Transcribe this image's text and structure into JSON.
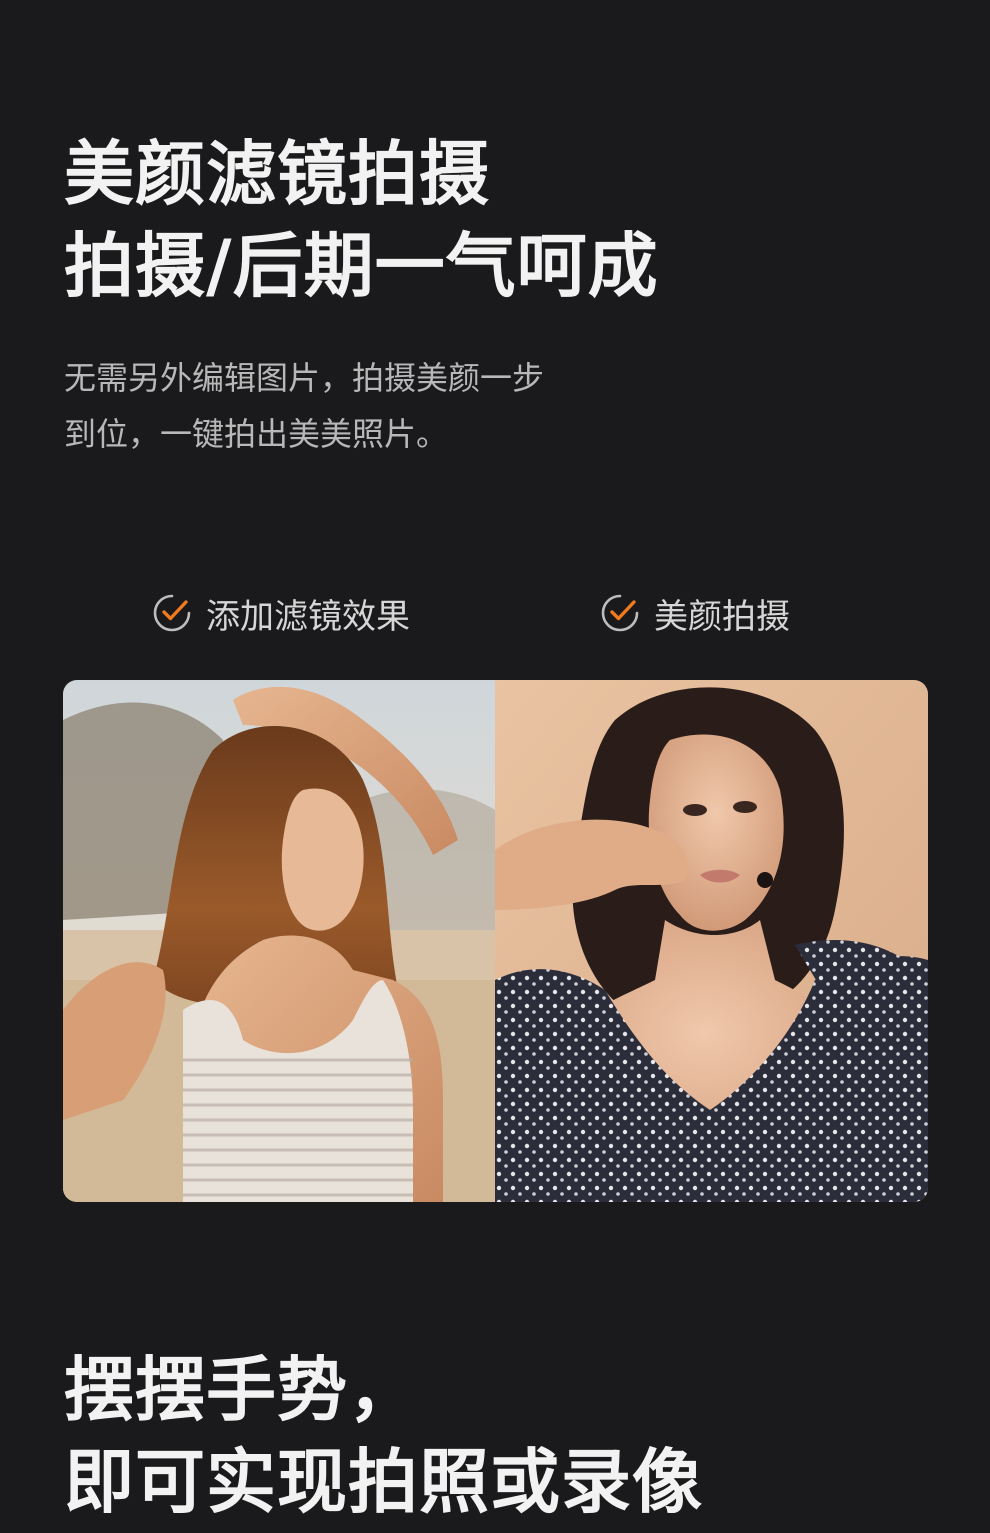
{
  "section1": {
    "title_line1": "美颜滤镜拍摄",
    "title_line2": "拍摄/后期一气呵成",
    "desc_line1": "无需另外编辑图片，拍摄美颜一步",
    "desc_line2": "到位，一键拍出美美照片。"
  },
  "features": [
    {
      "label": "添加滤镜效果",
      "icon": "check-circle-icon"
    },
    {
      "label": "美颜拍摄",
      "icon": "check-circle-icon"
    }
  ],
  "section2": {
    "title_line1": "摆摆手势，",
    "title_line2": "即可实现拍照或录像"
  },
  "colors": {
    "background": "#1a1a1c",
    "accent": "#f07a1e",
    "heading": "#f2f2f2",
    "body_text": "#b8b8b8"
  }
}
